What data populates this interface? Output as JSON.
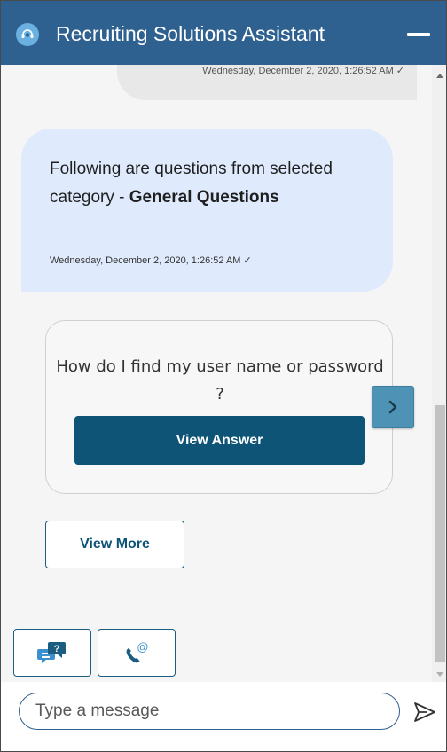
{
  "header": {
    "title": "Recruiting Solutions Assistant",
    "logo_icon": "headset-icon",
    "minimize_icon": "minimize-icon",
    "bg_color": "#2f6190"
  },
  "conversation": {
    "user_message": {
      "timestamp": "Wednesday, December 2, 2020, 1:26:52 AM ✓"
    },
    "bot_message": {
      "text_prefix": "Following are questions from selected category - ",
      "text_bold": "General Questions",
      "timestamp": "Wednesday, December 2, 2020, 1:26:52 AM ✓"
    },
    "faq_card": {
      "question": "How do I find my user name or password ?",
      "button_label": "View Answer",
      "next_icon": "chevron-right-icon"
    },
    "view_more_label": "View More",
    "quick_actions": [
      {
        "icon": "faq-chat-icon"
      },
      {
        "icon": "phone-email-icon"
      }
    ]
  },
  "footer": {
    "input_placeholder": "Type a message",
    "input_value": "",
    "send_icon": "send-icon"
  },
  "colors": {
    "accent": "#0d5476",
    "bot_bubble": "#dfebfd",
    "user_bubble": "#e8e8e8"
  }
}
